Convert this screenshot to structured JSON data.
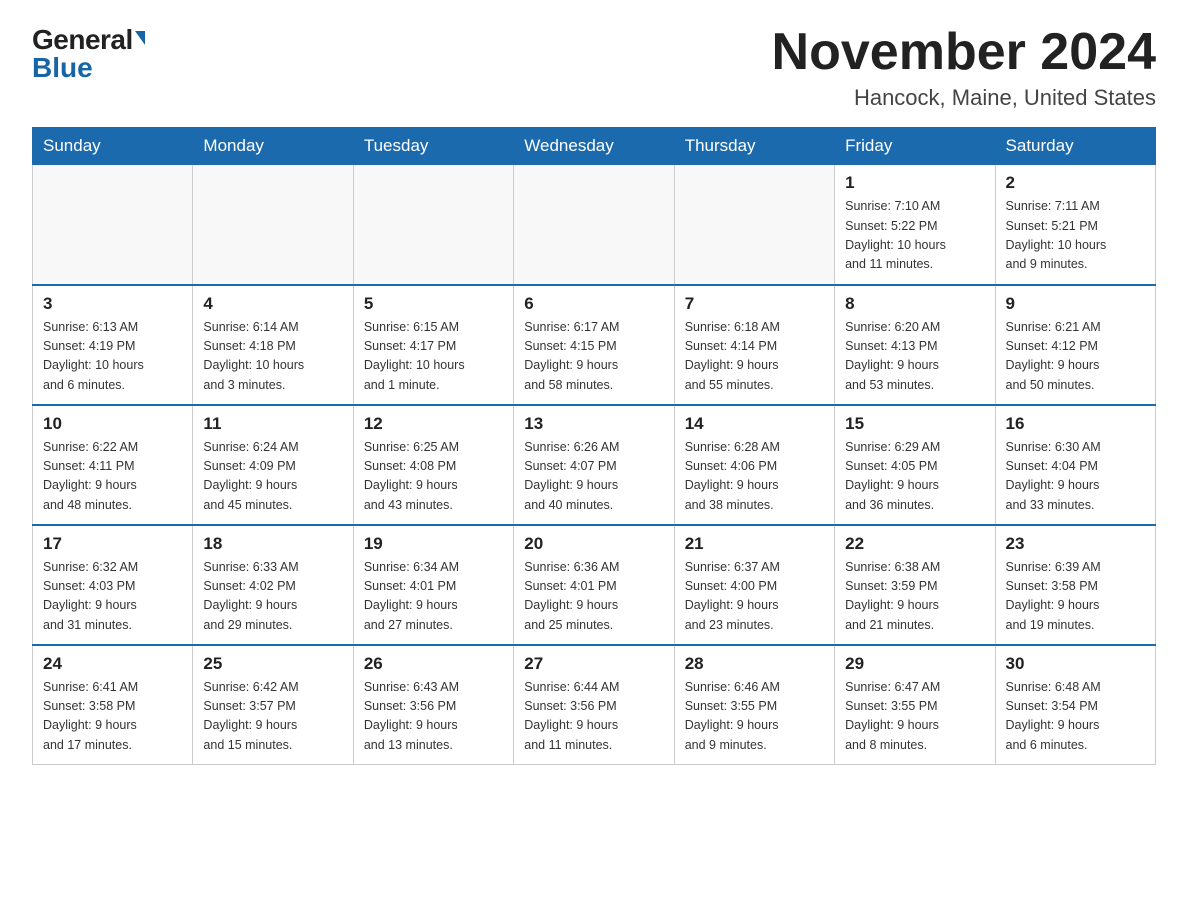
{
  "header": {
    "logo_general": "General",
    "logo_blue": "Blue",
    "month_title": "November 2024",
    "location": "Hancock, Maine, United States"
  },
  "weekdays": [
    "Sunday",
    "Monday",
    "Tuesday",
    "Wednesday",
    "Thursday",
    "Friday",
    "Saturday"
  ],
  "weeks": [
    [
      {
        "day": "",
        "info": ""
      },
      {
        "day": "",
        "info": ""
      },
      {
        "day": "",
        "info": ""
      },
      {
        "day": "",
        "info": ""
      },
      {
        "day": "",
        "info": ""
      },
      {
        "day": "1",
        "info": "Sunrise: 7:10 AM\nSunset: 5:22 PM\nDaylight: 10 hours\nand 11 minutes."
      },
      {
        "day": "2",
        "info": "Sunrise: 7:11 AM\nSunset: 5:21 PM\nDaylight: 10 hours\nand 9 minutes."
      }
    ],
    [
      {
        "day": "3",
        "info": "Sunrise: 6:13 AM\nSunset: 4:19 PM\nDaylight: 10 hours\nand 6 minutes."
      },
      {
        "day": "4",
        "info": "Sunrise: 6:14 AM\nSunset: 4:18 PM\nDaylight: 10 hours\nand 3 minutes."
      },
      {
        "day": "5",
        "info": "Sunrise: 6:15 AM\nSunset: 4:17 PM\nDaylight: 10 hours\nand 1 minute."
      },
      {
        "day": "6",
        "info": "Sunrise: 6:17 AM\nSunset: 4:15 PM\nDaylight: 9 hours\nand 58 minutes."
      },
      {
        "day": "7",
        "info": "Sunrise: 6:18 AM\nSunset: 4:14 PM\nDaylight: 9 hours\nand 55 minutes."
      },
      {
        "day": "8",
        "info": "Sunrise: 6:20 AM\nSunset: 4:13 PM\nDaylight: 9 hours\nand 53 minutes."
      },
      {
        "day": "9",
        "info": "Sunrise: 6:21 AM\nSunset: 4:12 PM\nDaylight: 9 hours\nand 50 minutes."
      }
    ],
    [
      {
        "day": "10",
        "info": "Sunrise: 6:22 AM\nSunset: 4:11 PM\nDaylight: 9 hours\nand 48 minutes."
      },
      {
        "day": "11",
        "info": "Sunrise: 6:24 AM\nSunset: 4:09 PM\nDaylight: 9 hours\nand 45 minutes."
      },
      {
        "day": "12",
        "info": "Sunrise: 6:25 AM\nSunset: 4:08 PM\nDaylight: 9 hours\nand 43 minutes."
      },
      {
        "day": "13",
        "info": "Sunrise: 6:26 AM\nSunset: 4:07 PM\nDaylight: 9 hours\nand 40 minutes."
      },
      {
        "day": "14",
        "info": "Sunrise: 6:28 AM\nSunset: 4:06 PM\nDaylight: 9 hours\nand 38 minutes."
      },
      {
        "day": "15",
        "info": "Sunrise: 6:29 AM\nSunset: 4:05 PM\nDaylight: 9 hours\nand 36 minutes."
      },
      {
        "day": "16",
        "info": "Sunrise: 6:30 AM\nSunset: 4:04 PM\nDaylight: 9 hours\nand 33 minutes."
      }
    ],
    [
      {
        "day": "17",
        "info": "Sunrise: 6:32 AM\nSunset: 4:03 PM\nDaylight: 9 hours\nand 31 minutes."
      },
      {
        "day": "18",
        "info": "Sunrise: 6:33 AM\nSunset: 4:02 PM\nDaylight: 9 hours\nand 29 minutes."
      },
      {
        "day": "19",
        "info": "Sunrise: 6:34 AM\nSunset: 4:01 PM\nDaylight: 9 hours\nand 27 minutes."
      },
      {
        "day": "20",
        "info": "Sunrise: 6:36 AM\nSunset: 4:01 PM\nDaylight: 9 hours\nand 25 minutes."
      },
      {
        "day": "21",
        "info": "Sunrise: 6:37 AM\nSunset: 4:00 PM\nDaylight: 9 hours\nand 23 minutes."
      },
      {
        "day": "22",
        "info": "Sunrise: 6:38 AM\nSunset: 3:59 PM\nDaylight: 9 hours\nand 21 minutes."
      },
      {
        "day": "23",
        "info": "Sunrise: 6:39 AM\nSunset: 3:58 PM\nDaylight: 9 hours\nand 19 minutes."
      }
    ],
    [
      {
        "day": "24",
        "info": "Sunrise: 6:41 AM\nSunset: 3:58 PM\nDaylight: 9 hours\nand 17 minutes."
      },
      {
        "day": "25",
        "info": "Sunrise: 6:42 AM\nSunset: 3:57 PM\nDaylight: 9 hours\nand 15 minutes."
      },
      {
        "day": "26",
        "info": "Sunrise: 6:43 AM\nSunset: 3:56 PM\nDaylight: 9 hours\nand 13 minutes."
      },
      {
        "day": "27",
        "info": "Sunrise: 6:44 AM\nSunset: 3:56 PM\nDaylight: 9 hours\nand 11 minutes."
      },
      {
        "day": "28",
        "info": "Sunrise: 6:46 AM\nSunset: 3:55 PM\nDaylight: 9 hours\nand 9 minutes."
      },
      {
        "day": "29",
        "info": "Sunrise: 6:47 AM\nSunset: 3:55 PM\nDaylight: 9 hours\nand 8 minutes."
      },
      {
        "day": "30",
        "info": "Sunrise: 6:48 AM\nSunset: 3:54 PM\nDaylight: 9 hours\nand 6 minutes."
      }
    ]
  ]
}
